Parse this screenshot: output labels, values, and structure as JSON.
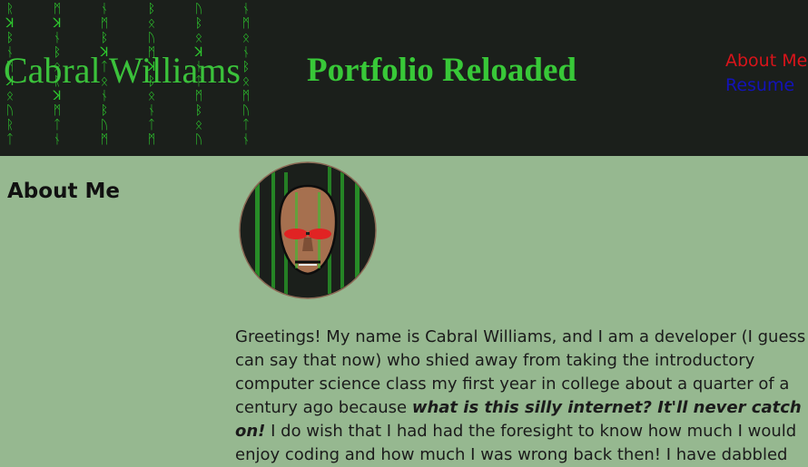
{
  "header": {
    "site_name": "Cabral Williams",
    "tagline": "Portfolio Reloaded",
    "rain_icon": "matrix-rain-glyphs"
  },
  "nav": {
    "about_label": "About Me",
    "resume_label": "Resume"
  },
  "main": {
    "section_title": "About Me",
    "avatar_icon": "matrix-face-avatar",
    "intro_part1": "Greetings! My name is Cabral Williams, and I am a developer (I guess I can say that now) who shied away from taking the introductory computer science class my first year in college about a quarter of a century ago because ",
    "intro_emphasis": "what is this silly internet? It'll never catch on!",
    "intro_part2": " I do wish that I had had the foresight to know how much I would enjoy coding and how much I was wrong back then! I have dabbled"
  },
  "colors": {
    "header_bg": "#1b1f1b",
    "page_bg": "#96b890",
    "matrix_green": "#38c838",
    "about_link": "#d8141a",
    "resume_link": "#1313b8"
  }
}
